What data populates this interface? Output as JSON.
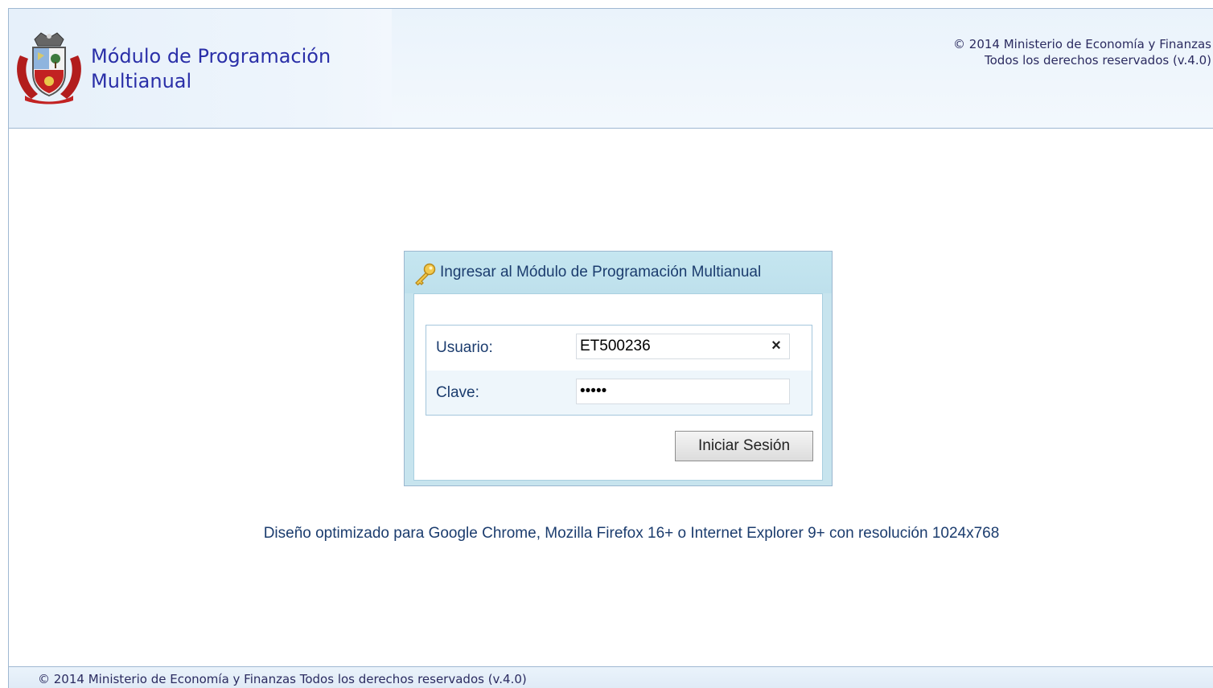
{
  "header": {
    "title_line1": "Módulo de Programación",
    "title_line2": "Multianual",
    "copyright_line1": "© 2014 Ministerio de Economía y Finanzas",
    "copyright_line2": "Todos los derechos reservados (v.4.0)"
  },
  "login": {
    "title": "Ingresar al Módulo de Programación Multianual",
    "username_label": "Usuario:",
    "username_value": "ET500236",
    "password_label": "Clave:",
    "password_value": "*****",
    "submit_label": "Iniciar Sesión",
    "clear_symbol": "×"
  },
  "note": "Diseño optimizado para Google Chrome, Mozilla Firefox 16+ o Internet Explorer 9+ con resolución 1024x768",
  "footer": {
    "text": "© 2014 Ministerio de Economía y Finanzas Todos los derechos reservados (v.4.0)"
  },
  "icons": {
    "logo": "coat-of-arms-logo",
    "login": "key-icon",
    "clear": "clear-icon"
  },
  "colors": {
    "title_blue": "#2a2fa8",
    "text_dark_blue": "#1b3c6e",
    "panel_bg": "#c7e4ee"
  }
}
